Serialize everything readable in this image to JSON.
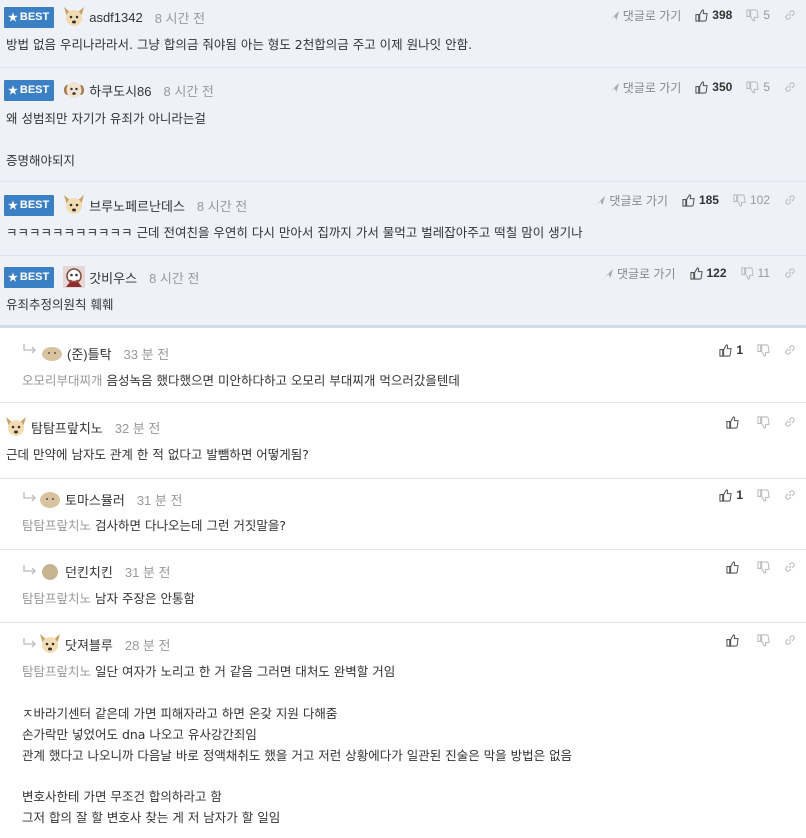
{
  "labels": {
    "best": "BEST",
    "reply_link": "댓글로 가기"
  },
  "best_comments": [
    {
      "nick": "asdf1342",
      "time": "8 시간 전",
      "likes": "398",
      "dislikes": "5",
      "text": "방법 없음 우리나라라서. 그냥 합의금 줘야됨 아는 형도 2천합의금 주고 이제 원나잇 안함."
    },
    {
      "nick": "하쿠도시86",
      "time": "8 시간 전",
      "likes": "350",
      "dislikes": "5",
      "text": "왜 성범죄만 자기가 유죄가 아니라는걸\n\n증명해야되지"
    },
    {
      "nick": "브루노페르난데스",
      "time": "8 시간 전",
      "likes": "185",
      "dislikes": "102",
      "text": "ㅋㅋㅋㅋㅋㅋㅋㅋㅋㅋㅋ 근데 전여친을 우연히 다시 만아서 집까지 가서 물먹고 벌레잡아주고 떡칠 맘이 생기나"
    },
    {
      "nick": "갓비우스",
      "time": "8 시간 전",
      "likes": "122",
      "dislikes": "11",
      "text": "유죄추정의원칙 훼훼"
    }
  ],
  "comments": [
    {
      "nick": "(준)틀탁",
      "time": "33 분 전",
      "likes": "1",
      "mention": "오모리부대찌개",
      "text": "음성녹음 했다했으면 미안하다하고 오모리 부대찌개 먹으러갔을텐데"
    },
    {
      "nick": "탐탐프랖치노",
      "time": "32 분 전",
      "likes": "",
      "mention": "",
      "text": "근데 만약에 남자도 관계 한 적 없다고 발뺌하면 어떻게됨?"
    },
    {
      "nick": "토마스뮬러",
      "time": "31 분 전",
      "likes": "1",
      "mention": "탐탐프랖치노",
      "text": "검사하면 다나오는데 그런 거짓말을?"
    },
    {
      "nick": "던킨치킨",
      "time": "31 분 전",
      "likes": "",
      "mention": "탐탐프랖치노",
      "text": "남자 주장은 안통함"
    },
    {
      "nick": "닷져블루",
      "time": "28 분 전",
      "likes": "",
      "mention": "탐탐프랖치노",
      "text": "일단 여자가 노리고 한 거 같음 그러면 대처도 완벽할 거임",
      "extra": "ㅈ바라기센터 같은데 가면 피해자라고 하면 온갖 지원 다해줌\n손가락만 넣었어도 dna 나오고 유사강간죄임\n관계 했다고 나오니까 다음날 바로 정액채취도 했을 거고 저런 상황에다가 일관된 진술은 막을 방법은 없음\n\n변호사한테 가면 무조건 합의하라고 함\n그저 합의 잘 할 변호사 찾는 게 저 남자가 할 일임"
    }
  ],
  "colors": {
    "best_badge": "#3b7fc4",
    "best_row_bg": "#eef2f8",
    "mention": "#999999"
  }
}
